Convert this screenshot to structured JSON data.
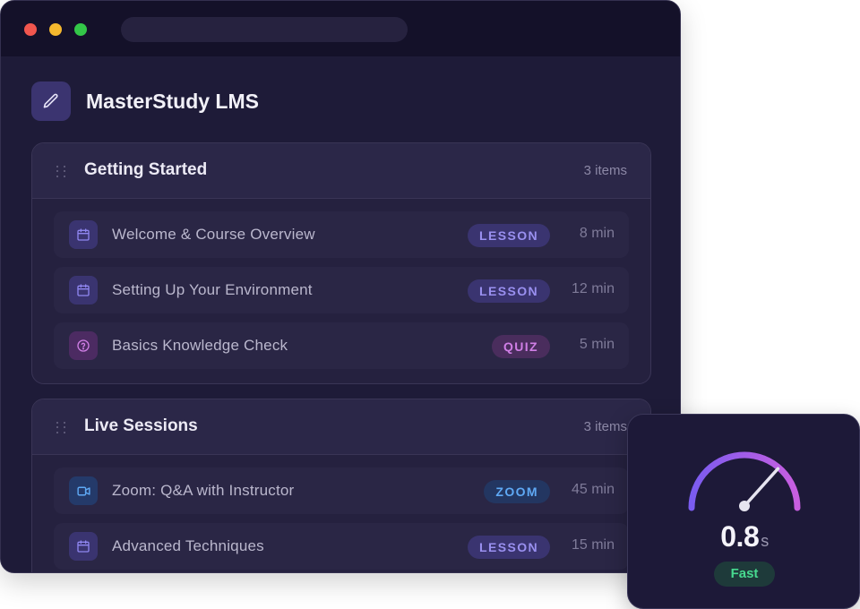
{
  "app": {
    "title": "MasterStudy LMS"
  },
  "sections": [
    {
      "title": "Getting Started",
      "count": "3 items",
      "items": [
        {
          "title": "Welcome & Course Overview",
          "type": "LESSON",
          "duration": "8 min",
          "icon": "calendar-icon"
        },
        {
          "title": "Setting Up Your Environment",
          "type": "LESSON",
          "duration": "12 min",
          "icon": "calendar-icon"
        },
        {
          "title": "Basics Knowledge Check",
          "type": "QUIZ",
          "duration": "5 min",
          "icon": "question-circle-icon"
        }
      ]
    },
    {
      "title": "Live Sessions",
      "count": "3 items",
      "items": [
        {
          "title": "Zoom: Q&A with Instructor",
          "type": "ZOOM",
          "duration": "45 min",
          "icon": "video-camera-icon"
        },
        {
          "title": "Advanced Techniques",
          "type": "LESSON",
          "duration": "15 min",
          "icon": "calendar-icon"
        }
      ]
    }
  ],
  "speed_gauge": {
    "value": "0.8",
    "unit": "s",
    "status": "Fast",
    "level": 0.8
  },
  "colors": {
    "lesson_badge": "#9a90f0",
    "quiz_badge": "#d07fe6",
    "zoom_badge": "#5fa9f5",
    "fast_status": "#47d98f"
  }
}
